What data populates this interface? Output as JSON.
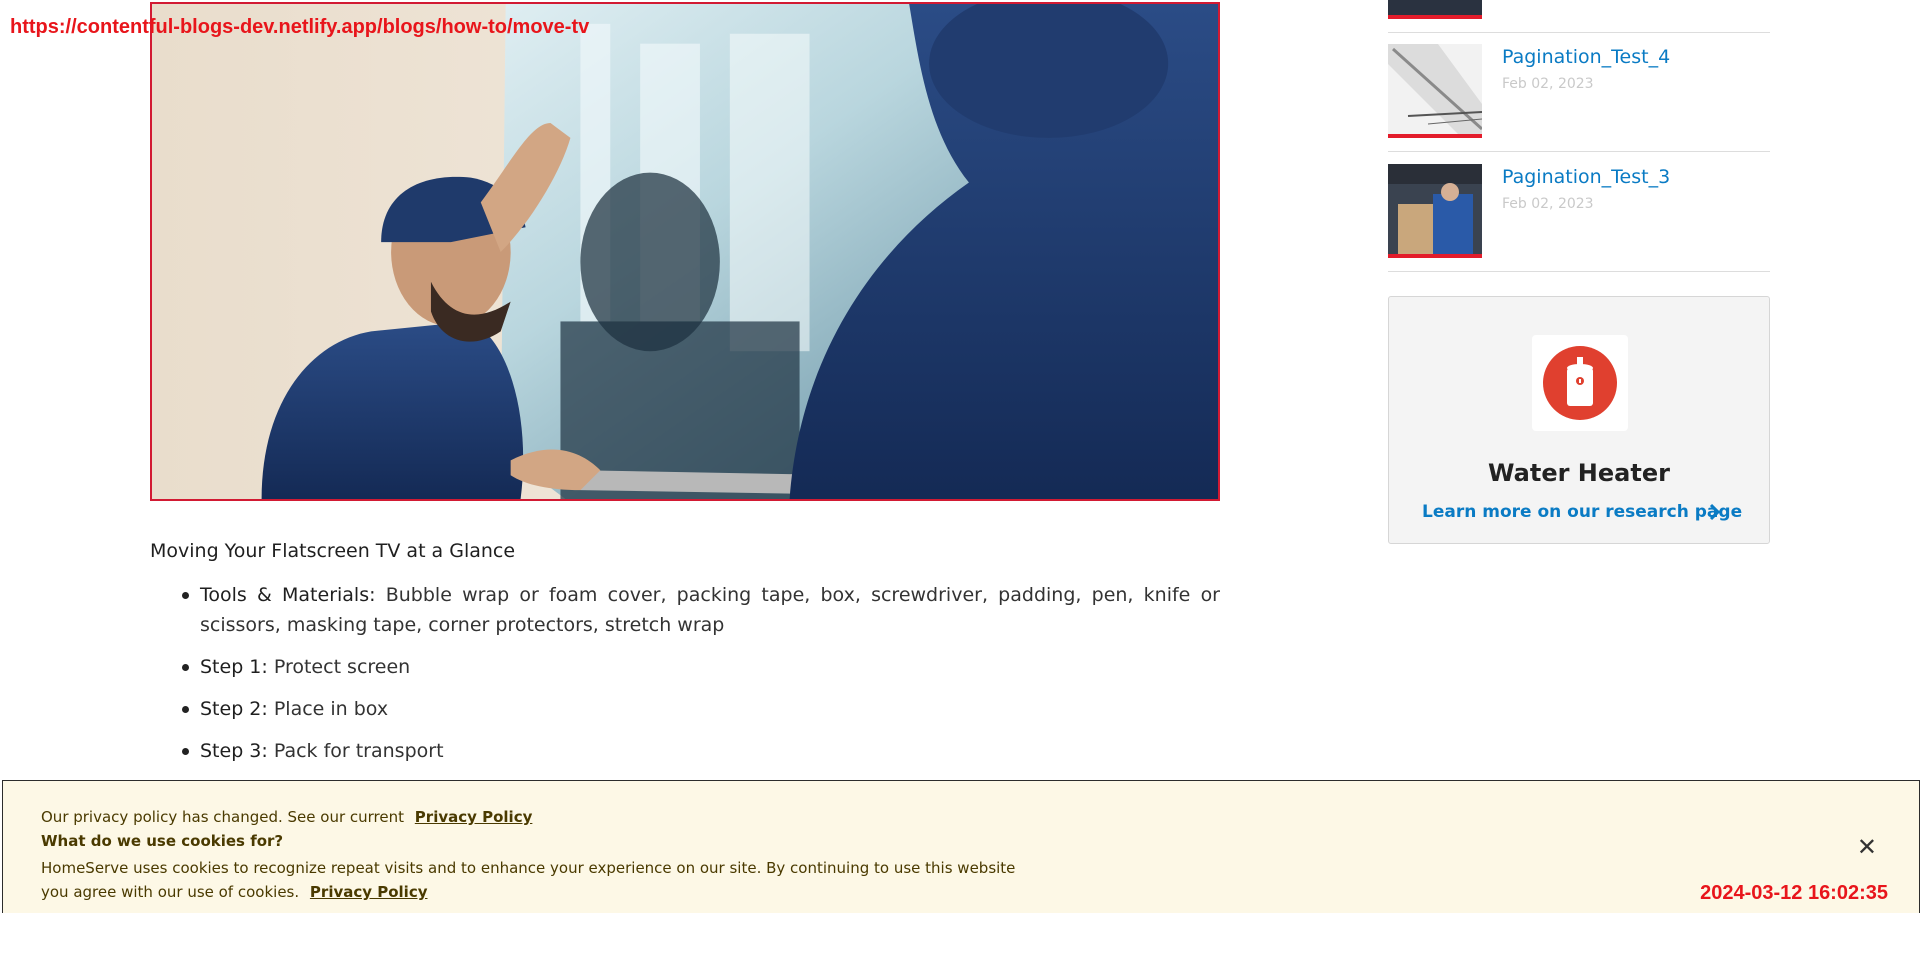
{
  "overlay": {
    "url": "https://contentful-blogs-dev.netlify.app/blogs/how-to/move-tv",
    "timestamp": "2024-03-12 16:02:35"
  },
  "article": {
    "heading": "Moving Your Flatscreen TV at a Glance",
    "items": [
      {
        "label": "Tools & Materials:",
        "text": " Bubble wrap or foam cover, packing tape, box, screwdriver, padding, pen, knife or scissors, masking tape, corner protectors, stretch wrap"
      },
      {
        "label": "Step 1:",
        "text": " Protect screen"
      },
      {
        "label": "Step 2:",
        "text": " Place in box"
      },
      {
        "label": "Step 3:",
        "text": " Pack for transport"
      }
    ]
  },
  "sidebar": {
    "posts": [
      {
        "title": "Pagination_Test_4",
        "date": "Feb 02, 2023"
      },
      {
        "title": "Pagination_Test_3",
        "date": "Feb 02, 2023"
      }
    ],
    "card": {
      "title": "Water Heater",
      "link": "Learn more on our research page",
      "icon": "water-heater-icon"
    }
  },
  "cookie": {
    "line1": "Our privacy policy has changed. See our current",
    "link1": "Privacy Policy",
    "line2": "What do we use cookies for?",
    "line3": "HomeServe uses cookies to recognize repeat visits and to enhance your experience on our site. By continuing to use this website you agree with our use of cookies.",
    "link2": "Privacy Policy",
    "close": "✕"
  },
  "colors": {
    "accent_red": "#e31c2b",
    "link_blue": "#0a7bc4",
    "banner_bg": "#fdf8e6"
  }
}
